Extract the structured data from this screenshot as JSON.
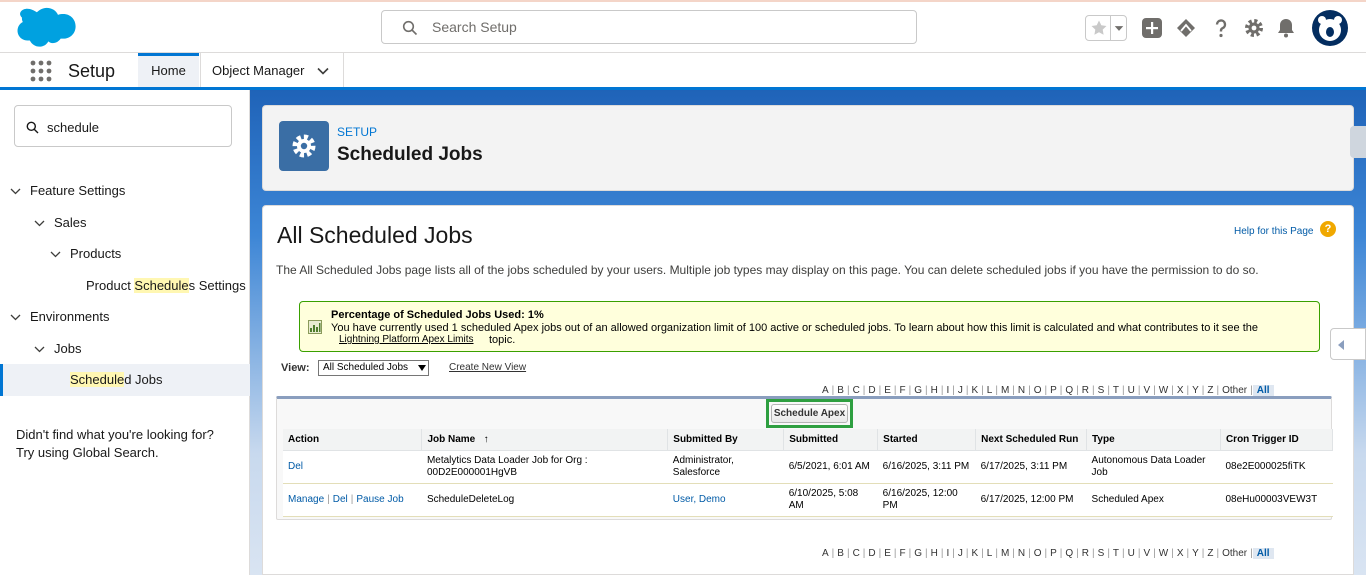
{
  "colors": {
    "brand": "#0176d3",
    "banner": "#ffffdc",
    "highlight": "#fff7b2",
    "schedule_border": "#2e9f40"
  },
  "header": {
    "search_placeholder": "Search Setup",
    "icons": [
      "salesforce-logo",
      "search-icon",
      "star-icon",
      "chevron-down-icon",
      "plus-icon",
      "trailhead-icon",
      "help-icon",
      "gear-icon",
      "bell-icon",
      "avatar"
    ]
  },
  "nav": {
    "app_name": "Setup",
    "tabs": [
      {
        "label": "Home"
      },
      {
        "label": "Object Manager"
      }
    ]
  },
  "sidebar": {
    "quickfind_value": "schedule",
    "feature_settings": "Feature Settings",
    "sales": "Sales",
    "products": "Products",
    "product_sched_pre": "Product ",
    "product_sched_hl": "Schedule",
    "product_sched_post": "s Settings",
    "environments": "Environments",
    "jobs": "Jobs",
    "sched_jobs_hl": "Schedule",
    "sched_jobs_post": "d Jobs",
    "help_line1": "Didn't find what you're looking for?",
    "help_line2": "Try using Global Search."
  },
  "page_header": {
    "eyebrow": "SETUP",
    "title": "Scheduled Jobs"
  },
  "content": {
    "title": "All Scheduled Jobs",
    "help_link": "Help for this Page",
    "description": "The All Scheduled Jobs page lists all of the jobs scheduled by your users. Multiple job types may display on this page. You can delete scheduled jobs if you have the permission to do so.",
    "banner": {
      "title": "Percentage of Scheduled Jobs Used: 1%",
      "body": "You have currently used 1 scheduled Apex jobs out of an allowed organization limit of 100 active or scheduled jobs. To learn about how this limit is calculated and what contributes to it see the",
      "link": "Lightning Platform Apex Limits",
      "tail": "topic."
    },
    "view_label": "View:",
    "view_selected": "All Scheduled Jobs",
    "create_view": "Create New View",
    "alphabet": [
      "A",
      "B",
      "C",
      "D",
      "E",
      "F",
      "G",
      "H",
      "I",
      "J",
      "K",
      "L",
      "M",
      "N",
      "O",
      "P",
      "Q",
      "R",
      "S",
      "T",
      "U",
      "V",
      "W",
      "X",
      "Y",
      "Z",
      "Other",
      "All"
    ],
    "schedule_apex": "Schedule Apex"
  },
  "table": {
    "headers": [
      "Action",
      "Job Name",
      "Submitted By",
      "Submitted",
      "Started",
      "Next Scheduled Run",
      "Type",
      "Cron Trigger ID"
    ],
    "sort_indicator": "↑",
    "rows": [
      {
        "actions": [
          "Del"
        ],
        "job_name": "Metalytics Data Loader Job for Org : 00D2E000001HgVB",
        "submitted_by": "Administrator, Salesforce",
        "submitted": "6/5/2021, 6:01 AM",
        "started": "6/16/2025, 3:11 PM",
        "next_run": "6/17/2025, 3:11 PM",
        "type": "Autonomous Data Loader Job",
        "cron_id": "08e2E000025fiTK"
      },
      {
        "actions": [
          "Manage",
          "Del",
          "Pause Job"
        ],
        "job_name": "ScheduleDeleteLog",
        "submitted_by": "User, Demo",
        "submitted": "6/10/2025, 5:08 AM",
        "started": "6/16/2025, 12:00 PM",
        "next_run": "6/17/2025, 12:00 PM",
        "type": "Scheduled Apex",
        "cron_id": "08eHu00003VEW3T"
      }
    ]
  }
}
